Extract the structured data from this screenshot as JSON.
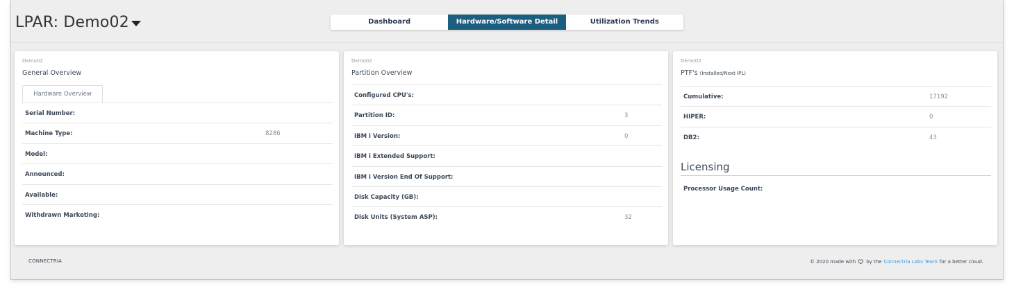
{
  "header": {
    "lpar_title": "LPAR: Demo02"
  },
  "tabs": [
    {
      "label": "Dashboard"
    },
    {
      "label": "Hardware/Software Detail"
    },
    {
      "label": "Utilization Trends"
    }
  ],
  "general": {
    "category": "Demo02",
    "title": "General Overview",
    "subtab": "Hardware Overview",
    "rows": [
      {
        "label": "Serial Number:",
        "value": ""
      },
      {
        "label": "Machine Type:",
        "value": "8286"
      },
      {
        "label": "Model:",
        "value": ""
      },
      {
        "label": "Announced:",
        "value": ""
      },
      {
        "label": "Available:",
        "value": ""
      },
      {
        "label": "Withdrawn Marketing:",
        "value": ""
      }
    ]
  },
  "partition": {
    "category": "Demo02",
    "title": "Partition Overview",
    "rows": [
      {
        "label": "Configured CPU's:",
        "value": ""
      },
      {
        "label": "Partition ID:",
        "value": "3"
      },
      {
        "label": "IBM i Version:",
        "value": "0"
      },
      {
        "label": "IBM i Extended Support:",
        "value": ""
      },
      {
        "label": "IBM i Version End Of Support:",
        "value": ""
      },
      {
        "label": "Disk Capacity (GB):",
        "value": ""
      },
      {
        "label": "Disk Units (System ASP):",
        "value": "32"
      }
    ]
  },
  "ptfs": {
    "category": "Demo02",
    "title": "PTF's",
    "title_note": "(Installed/Next IPL)",
    "rows": [
      {
        "label": "Cumulative:",
        "value": "17192"
      },
      {
        "label": "HIPER:",
        "value": "0"
      },
      {
        "label": "DB2:",
        "value": "43"
      }
    ],
    "licensing_heading": "Licensing",
    "licensing_rows": [
      {
        "label": "Processor Usage Count:",
        "value": ""
      }
    ]
  },
  "footer": {
    "brand": "CONNECTRIA",
    "prefix": "© 2020 made with",
    "by": "by the",
    "team_link": "Connectria Labs Team",
    "suffix": "for a better cloud."
  },
  "colors": {
    "active_tab": "#1b5e80",
    "link": "#3b9ad9",
    "background": "#eeeeee"
  }
}
